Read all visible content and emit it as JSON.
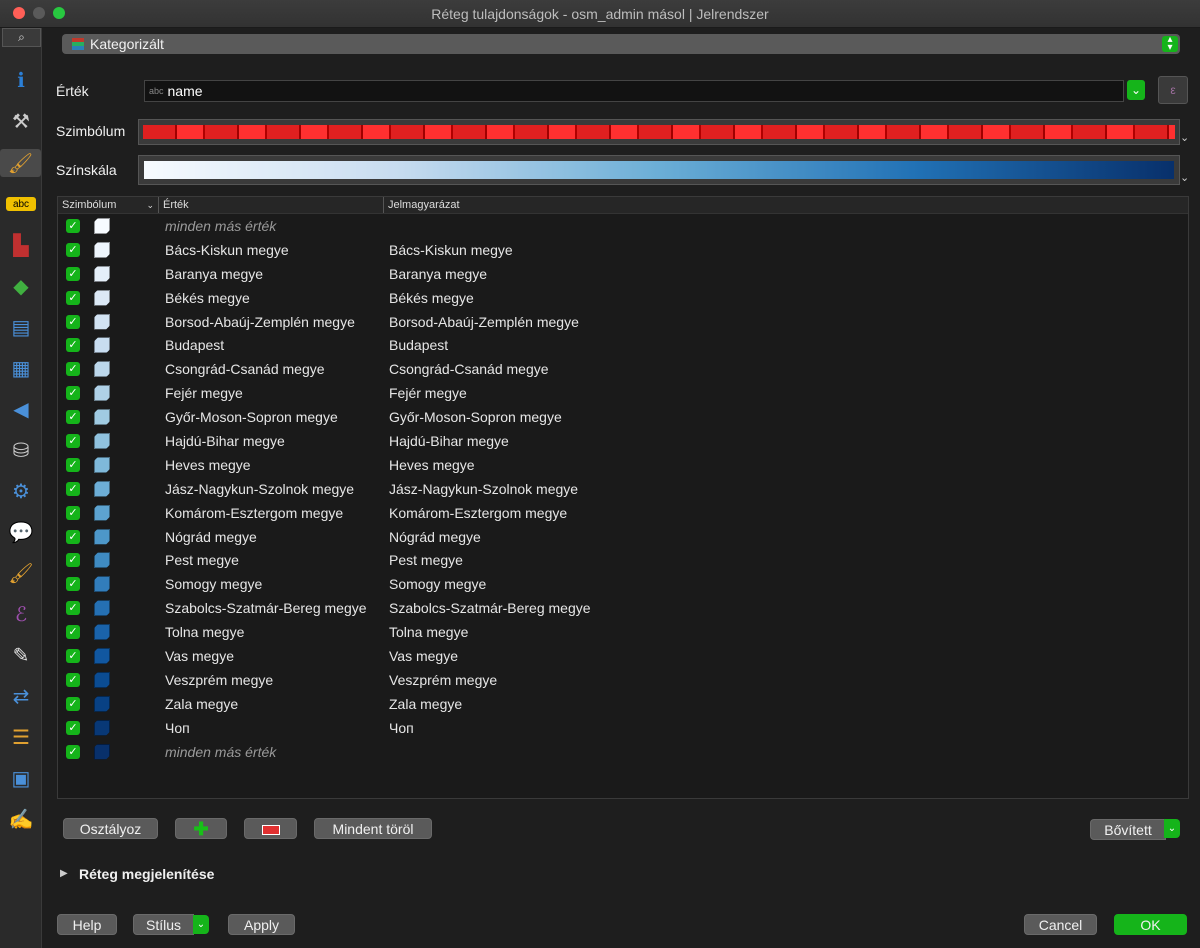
{
  "window": {
    "title": "Réteg tulajdonságok - osm_admin másol | Jelrendszer"
  },
  "sidebar": {
    "search_icon": "⌕",
    "items": [
      {
        "name": "information-icon",
        "glyph": "ℹ",
        "color": "#2b7fd6"
      },
      {
        "name": "source-icon",
        "glyph": "⚒",
        "color": "#cccccc"
      },
      {
        "name": "symbology-icon",
        "glyph": "🖌",
        "color": "#e0a030",
        "active": true
      },
      {
        "name": "labels-icon",
        "glyph": "abc",
        "color": "#f0c000"
      },
      {
        "name": "diagrams-icon",
        "glyph": "▙",
        "color": "#c03030"
      },
      {
        "name": "3d-view-icon",
        "glyph": "◆",
        "color": "#40b040"
      },
      {
        "name": "fields-icon",
        "glyph": "▤",
        "color": "#4a90d9"
      },
      {
        "name": "attributes-form-icon",
        "glyph": "▦",
        "color": "#4a90d9"
      },
      {
        "name": "joins-icon",
        "glyph": "◀",
        "color": "#4a90d9"
      },
      {
        "name": "auxiliary-storage-icon",
        "glyph": "⛁",
        "color": "#cccccc"
      },
      {
        "name": "actions-icon",
        "glyph": "⚙",
        "color": "#4a90d9"
      },
      {
        "name": "display-icon",
        "glyph": "💬",
        "color": "#f0c000"
      },
      {
        "name": "rendering-icon",
        "glyph": "🖌",
        "color": "#e0a030"
      },
      {
        "name": "variables-icon",
        "glyph": "ℰ",
        "color": "#a050b0"
      },
      {
        "name": "metadata-icon",
        "glyph": "✎",
        "color": "#e0e0e0"
      },
      {
        "name": "dependencies-icon",
        "glyph": "⇄",
        "color": "#4a90d9"
      },
      {
        "name": "legend-icon",
        "glyph": "☰",
        "color": "#e0a030"
      },
      {
        "name": "qgis-server-icon",
        "glyph": "▣",
        "color": "#4a90d9"
      },
      {
        "name": "digitizing-icon",
        "glyph": "✍",
        "color": "#e0e0e0"
      }
    ]
  },
  "renderer": {
    "label": "Kategorizált"
  },
  "value": {
    "label": "Érték",
    "type_badge": "abc",
    "field": "name",
    "expr_icon": "ε"
  },
  "symbol": {
    "label": "Szimbólum"
  },
  "ramp": {
    "label": "Színskála"
  },
  "table": {
    "headers": {
      "symbol": "Szimbólum",
      "value": "Érték",
      "legend": "Jelmagyarázat"
    },
    "rows": [
      {
        "value": "minden más érték",
        "legend": "",
        "italic": true,
        "color": "#f7fbff"
      },
      {
        "value": "Bács-Kiskun megye",
        "legend": "Bács-Kiskun megye",
        "color": "#eef5fc"
      },
      {
        "value": "Baranya megye",
        "legend": "Baranya megye",
        "color": "#e5eff9"
      },
      {
        "value": "Békés megye",
        "legend": "Békés megye",
        "color": "#dce9f6"
      },
      {
        "value": "Borsod-Abaúj-Zemplén megye",
        "legend": "Borsod-Abaúj-Zemplén megye",
        "color": "#d2e3f3"
      },
      {
        "value": "Budapest",
        "legend": "Budapest",
        "color": "#c8ddf0"
      },
      {
        "value": "Csongrád-Csanád megye",
        "legend": "Csongrád-Csanád megye",
        "color": "#bcd7eb"
      },
      {
        "value": "Fejér megye",
        "legend": "Fejér megye",
        "color": "#afd1e7"
      },
      {
        "value": "Győr-Moson-Sopron megye",
        "legend": "Győr-Moson-Sopron megye",
        "color": "#a0cbe2"
      },
      {
        "value": "Hajdú-Bihar megye",
        "legend": "Hajdú-Bihar megye",
        "color": "#90c2de"
      },
      {
        "value": "Heves megye",
        "legend": "Heves megye",
        "color": "#7fb9da"
      },
      {
        "value": "Jász-Nagykun-Szolnok megye",
        "legend": "Jász-Nagykun-Szolnok megye",
        "color": "#6daed6"
      },
      {
        "value": "Komárom-Esztergom megye",
        "legend": "Komárom-Esztergom megye",
        "color": "#5da3d0"
      },
      {
        "value": "Nógrád megye",
        "legend": "Nógrád megye",
        "color": "#4d97c9"
      },
      {
        "value": "Pest megye",
        "legend": "Pest megye",
        "color": "#3f8bc2"
      },
      {
        "value": "Somogy megye",
        "legend": "Somogy megye",
        "color": "#327dbb"
      },
      {
        "value": "Szabolcs-Szatmár-Bereg megye",
        "legend": "Szabolcs-Szatmár-Bereg megye",
        "color": "#2570b3"
      },
      {
        "value": "Tolna megye",
        "legend": "Tolna megye",
        "color": "#1a63aa"
      },
      {
        "value": "Vas megye",
        "legend": "Vas megye",
        "color": "#1157a0"
      },
      {
        "value": "Veszprém megye",
        "legend": "Veszprém megye",
        "color": "#0b4c92"
      },
      {
        "value": "Zala megye",
        "legend": "Zala megye",
        "color": "#084184"
      },
      {
        "value": "Чоп",
        "legend": "Чоп",
        "color": "#083876"
      },
      {
        "value": "minden más érték",
        "legend": "",
        "italic": true,
        "color": "#08306b"
      }
    ]
  },
  "buttons": {
    "classify": "Osztályoz",
    "add": "✚",
    "delete_all": "Mindent töröl",
    "advanced": "Bővített",
    "help": "Help",
    "style": "Stílus",
    "apply": "Apply",
    "cancel": "Cancel",
    "ok": "OK"
  },
  "layer_rendering": {
    "label": "Réteg megjelenítése"
  }
}
